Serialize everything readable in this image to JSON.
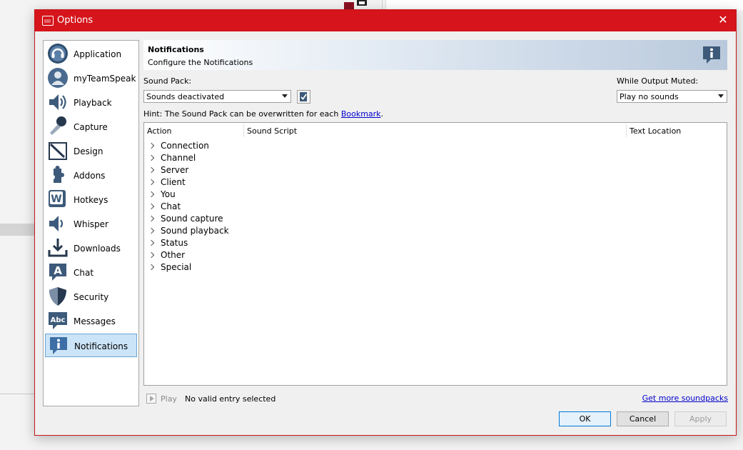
{
  "window": {
    "title": "Options",
    "close_glyph": "✕"
  },
  "sidebar": {
    "items": [
      {
        "label": "Application",
        "icon": "headset-icon",
        "selected": false
      },
      {
        "label": "myTeamSpeak",
        "icon": "user-icon",
        "selected": false
      },
      {
        "label": "Playback",
        "icon": "speaker-icon",
        "selected": false
      },
      {
        "label": "Capture",
        "icon": "microphone-icon",
        "selected": false
      },
      {
        "label": "Design",
        "icon": "design-icon",
        "selected": false
      },
      {
        "label": "Addons",
        "icon": "puzzle-icon",
        "selected": false
      },
      {
        "label": "Hotkeys",
        "icon": "keyboard-icon",
        "selected": false
      },
      {
        "label": "Whisper",
        "icon": "whisper-icon",
        "selected": false
      },
      {
        "label": "Downloads",
        "icon": "download-icon",
        "selected": false
      },
      {
        "label": "Chat",
        "icon": "chat-icon",
        "selected": false
      },
      {
        "label": "Security",
        "icon": "shield-icon",
        "selected": false
      },
      {
        "label": "Messages",
        "icon": "messages-icon",
        "selected": false
      },
      {
        "label": "Notifications",
        "icon": "info-icon",
        "selected": true
      }
    ]
  },
  "banner": {
    "title": "Notifications",
    "subtitle": "Configure the Notifications",
    "icon": "info-icon"
  },
  "sound_pack": {
    "label": "Sound Pack:",
    "value": "Sounds deactivated"
  },
  "output_muted": {
    "label": "While Output Muted:",
    "value": "Play no sounds"
  },
  "hint": {
    "text": "Hint: The Sound Pack can be overwritten for each ",
    "link": "Bookmark",
    "suffix": "."
  },
  "tree": {
    "columns": [
      "Action",
      "Sound Script",
      "Text Location"
    ],
    "rows": [
      "Connection",
      "Channel",
      "Server",
      "Client",
      "You",
      "Chat",
      "Sound capture",
      "Sound playback",
      "Status",
      "Other",
      "Special"
    ]
  },
  "footer": {
    "play_label": "Play",
    "status": "No valid entry selected",
    "more_link": "Get more soundpacks"
  },
  "buttons": {
    "ok": "OK",
    "cancel": "Cancel",
    "apply": "Apply"
  },
  "colors": {
    "titlebar": "#d5141b",
    "selection": "#cce4f7",
    "link": "#0000cc"
  }
}
